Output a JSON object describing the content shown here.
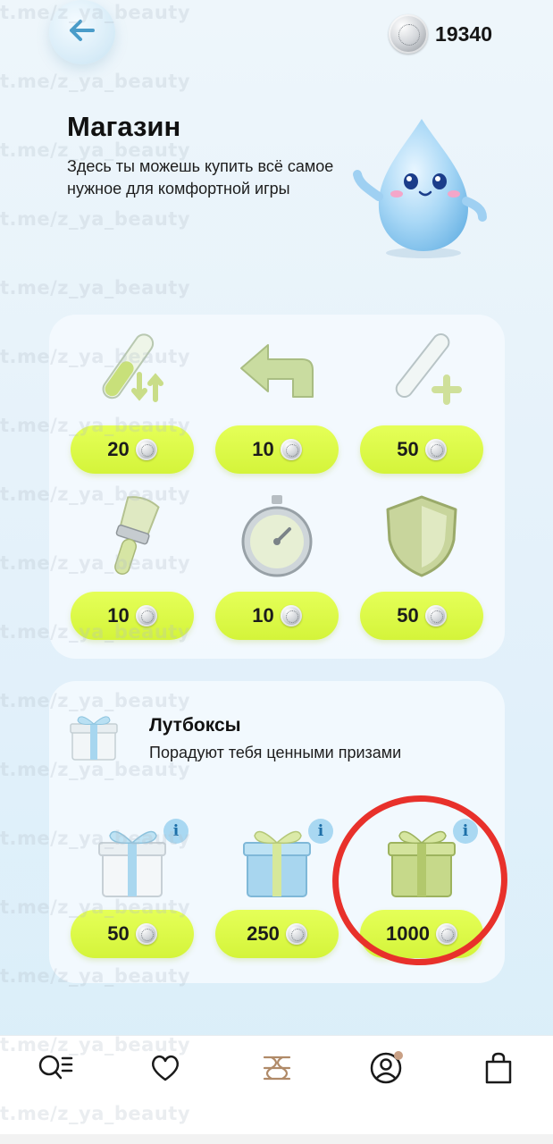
{
  "header": {
    "coins": "19340"
  },
  "hero": {
    "title": "Магазин",
    "subtitle": "Здесь ты можешь купить всё самое нужное для комфортной игры"
  },
  "shop_items": [
    {
      "icon": "test-tube-swap-icon",
      "price": "20"
    },
    {
      "icon": "undo-arrow-icon",
      "price": "10"
    },
    {
      "icon": "test-tube-plus-icon",
      "price": "50"
    },
    {
      "icon": "paint-brush-icon",
      "price": "10"
    },
    {
      "icon": "stopwatch-icon",
      "price": "10"
    },
    {
      "icon": "shield-icon",
      "price": "50"
    }
  ],
  "lootboxes": {
    "title": "Лутбоксы",
    "subtitle": "Порадуют тебя ценными призами",
    "items": [
      {
        "icon": "white-gift-icon",
        "price": "50"
      },
      {
        "icon": "blue-gift-icon",
        "price": "250"
      },
      {
        "icon": "green-gift-icon",
        "price": "1000"
      }
    ]
  },
  "watermark": "t.me/z_ya_beauty",
  "tabs": [
    "search-list-icon",
    "heart-icon",
    "game-logo-icon",
    "profile-icon",
    "shopping-bag-icon"
  ],
  "colors": {
    "price_button": "#dff94a",
    "highlight_ring": "#e8312b",
    "background": "#e4f1fa"
  }
}
